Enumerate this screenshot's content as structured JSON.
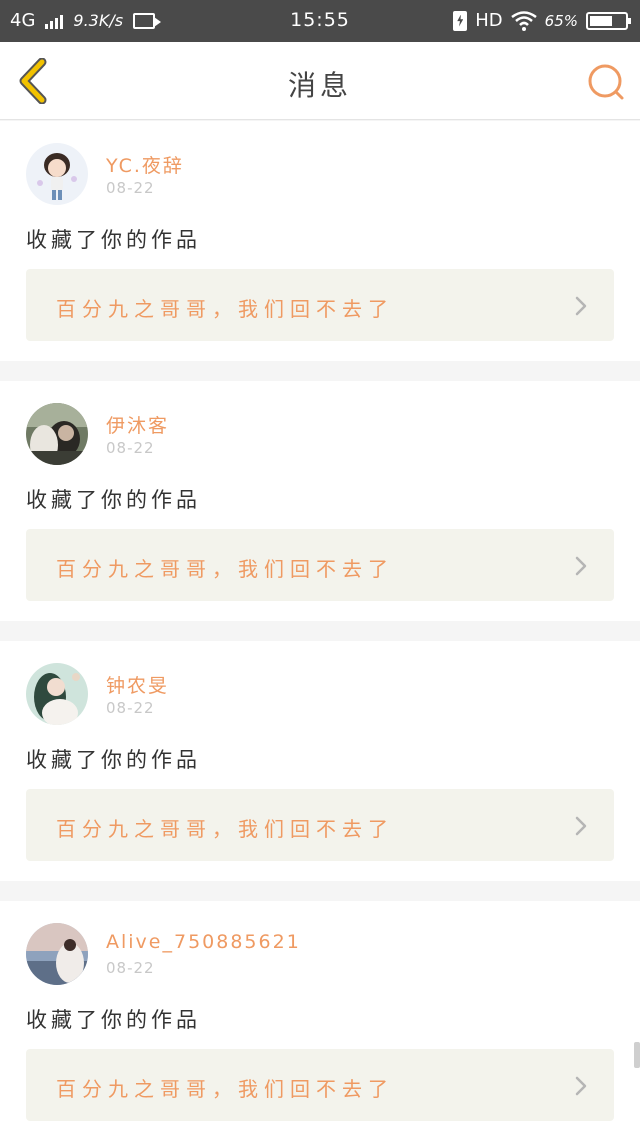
{
  "status_bar": {
    "network": "4G",
    "speed": "9.3K/s",
    "time": "15:55",
    "hd": "HD",
    "battery_text": "65%",
    "battery_level": 0.65
  },
  "nav": {
    "title": "消息",
    "accent_color": "#ef9a62",
    "back_color": "#f2c200"
  },
  "notifications": [
    {
      "username": "YC.夜辞",
      "date": "08-22",
      "action": "收藏了你的作品",
      "work_title": "百分九之哥哥，我们回不去了"
    },
    {
      "username": "伊沐客",
      "date": "08-22",
      "action": "收藏了你的作品",
      "work_title": "百分九之哥哥，我们回不去了"
    },
    {
      "username": "钟农旻",
      "date": "08-22",
      "action": "收藏了你的作品",
      "work_title": "百分九之哥哥，我们回不去了"
    },
    {
      "username": "Alive_750885621",
      "date": "08-22",
      "action": "收藏了你的作品",
      "work_title": "百分九之哥哥，我们回不去了"
    }
  ],
  "icons": {
    "back": "chevron-left-icon",
    "search": "search-icon",
    "chevron": "chevron-right-icon"
  }
}
